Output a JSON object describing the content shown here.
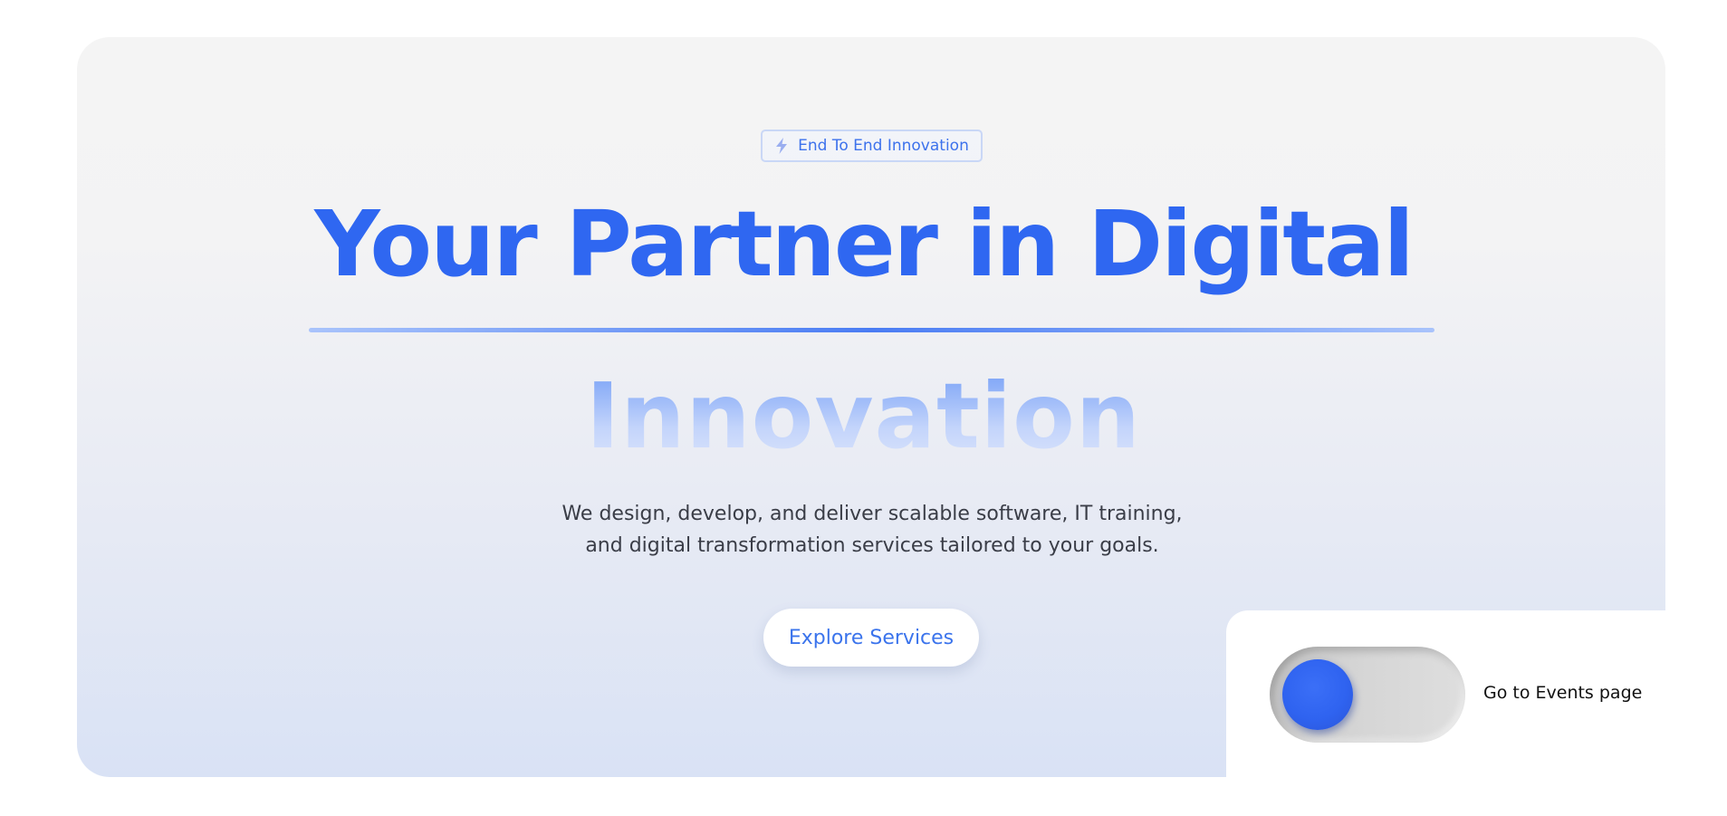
{
  "hero": {
    "badge": {
      "icon": "lightning-icon",
      "label": "End To End Innovation"
    },
    "title_line1": "Your Partner in Digital",
    "title_line2": "Innovation",
    "subtitle_line1": "We design, develop, and deliver scalable software, IT training,",
    "subtitle_line2": "and digital transformation services tailored to your goals.",
    "cta_label": "Explore Services"
  },
  "events_toggle": {
    "label": "Go to Events page",
    "state": "off"
  },
  "colors": {
    "accent": "#2f67f1",
    "cta_text": "#3b74ec",
    "body_text": "#3a3d47",
    "toggle_knob": "#2f63f0"
  }
}
